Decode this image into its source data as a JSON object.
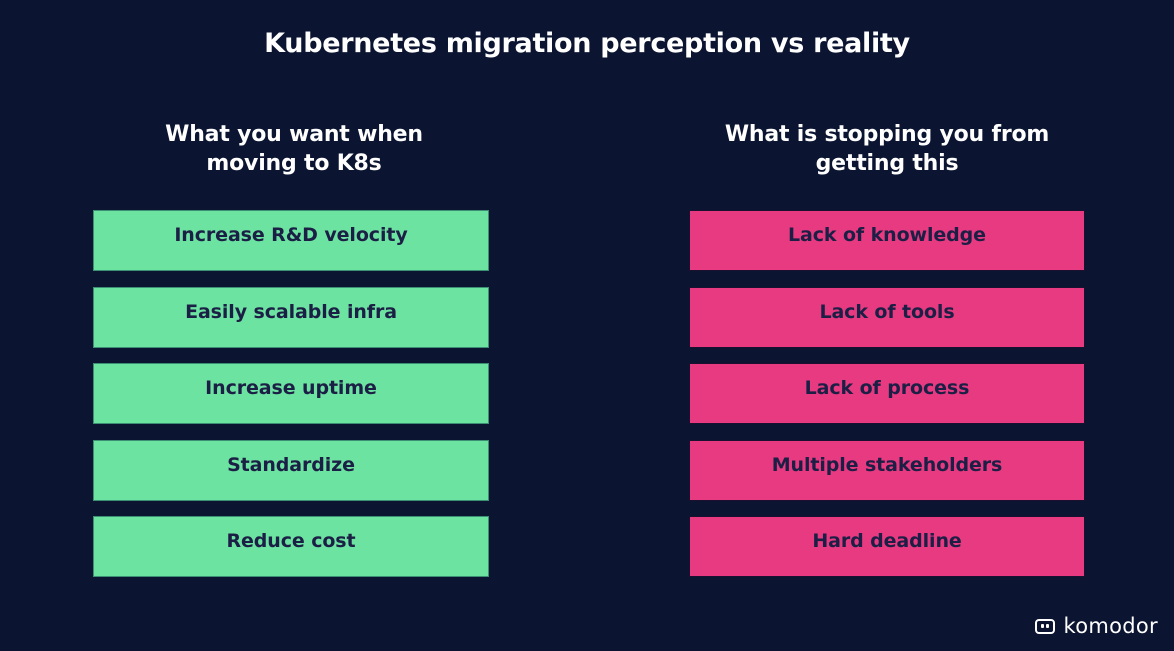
{
  "title": "Kubernetes migration perception vs reality",
  "colors": {
    "background": "#0b1430",
    "want": "#6ce3a0",
    "blocker": "#e73a80",
    "box_text": "#1c1f45"
  },
  "left_column": {
    "heading_line1": "What you want when",
    "heading_line2": "moving to K8s",
    "items": [
      {
        "label": "Increase R&D velocity"
      },
      {
        "label": "Easily scalable infra"
      },
      {
        "label": "Increase uptime"
      },
      {
        "label": "Standardize"
      },
      {
        "label": "Reduce cost"
      }
    ]
  },
  "right_column": {
    "heading_line1": "What is stopping you from",
    "heading_line2": "getting this",
    "items": [
      {
        "label": "Lack of knowledge"
      },
      {
        "label": "Lack of tools"
      },
      {
        "label": "Lack of process"
      },
      {
        "label": "Multiple stakeholders"
      },
      {
        "label": "Hard deadline"
      }
    ]
  },
  "brand": {
    "logo_icon": "komodor-logo-icon",
    "name": "komodor"
  }
}
